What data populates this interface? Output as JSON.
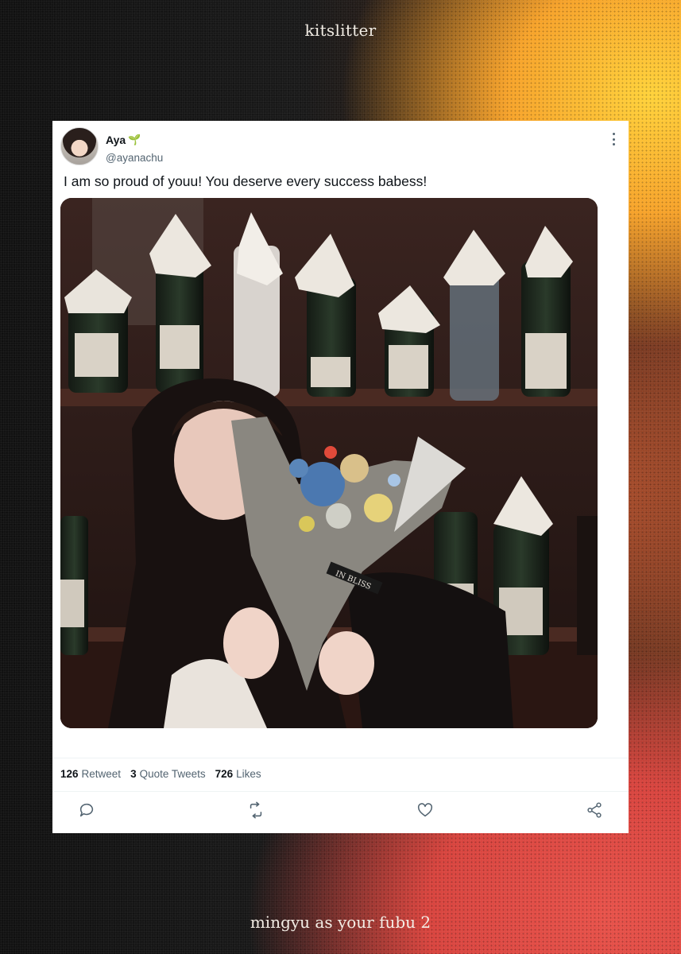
{
  "page": {
    "top_caption": "kitslitter",
    "bottom_caption": "mingyu as your fubu 2"
  },
  "tweet": {
    "name": "Aya",
    "name_emoji": "🌱",
    "handle": "@ayanachu",
    "text": "I am so proud of youu! You deserve every success babess!",
    "photo_wrap_label": "IN BLISS",
    "stats": {
      "retweets_count": "126",
      "retweets_label": "Retweet",
      "quotes_count": "3",
      "quotes_label": "Quote Tweets",
      "likes_count": "726",
      "likes_label": "Likes"
    },
    "icons": [
      "more-icon",
      "reply-icon",
      "retweet-icon",
      "like-icon",
      "share-icon"
    ]
  },
  "colors": {
    "text_primary": "#0f1419",
    "text_secondary": "#536471",
    "divider": "#eff3f4",
    "card_bg": "#ffffff"
  }
}
